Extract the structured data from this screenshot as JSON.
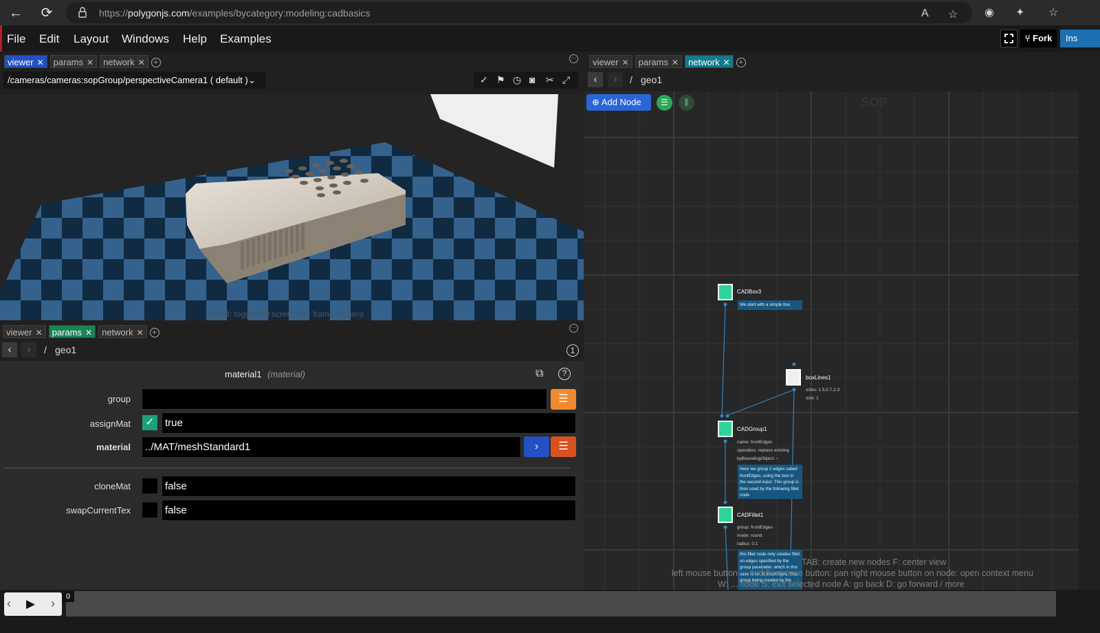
{
  "browser": {
    "url_prefix": "https://",
    "url_domain": "polygonjs.com",
    "url_path": "/examples/bycategory:modeling:cadbasics"
  },
  "menu": {
    "items": [
      "File",
      "Edit",
      "Layout",
      "Windows",
      "Help",
      "Examples"
    ],
    "fork_label": "Fork",
    "ins_label": "Ins"
  },
  "viewer_panel": {
    "tabs": [
      "viewer",
      "params",
      "network"
    ],
    "active_tab": "viewer",
    "camera_path": "/cameras/cameras:sopGroup/perspectiveCamera1 ( default )",
    "hint": "Ctrl+B: toggle full screen / F: frame camera"
  },
  "params_panel": {
    "tabs": [
      "viewer",
      "params",
      "network"
    ],
    "active_tab": "params",
    "path_sep": "/",
    "path": "geo1",
    "badge": "1",
    "node_name": "material1",
    "node_type": "(material)",
    "params": [
      {
        "label": "group",
        "value": ""
      },
      {
        "label": "assignMat",
        "value": "true"
      },
      {
        "label": "material",
        "value": "../MAT/meshStandard1"
      },
      {
        "label": "cloneMat",
        "value": "false"
      },
      {
        "label": "swapCurrentTex",
        "value": "false"
      }
    ]
  },
  "network_panel": {
    "tabs": [
      "viewer",
      "params",
      "network"
    ],
    "active_tab": "network",
    "path_sep": "/",
    "path": "geo1",
    "add_node_label": "Add Node",
    "context_label": "SOP",
    "nodes": [
      {
        "name": "CADBox3",
        "note": "We start with a simple box"
      },
      {
        "name": "boxLines1",
        "params": [
          "sizes: 1.5,0.7,2.3",
          "size: 1"
        ]
      },
      {
        "name": "CADGroup1",
        "params": [
          "name: frontEdges",
          "operation: replace existing",
          "byBoundingObject: ○"
        ],
        "note": "Here we group 2 edges called frontEdges, using the box in the second input. This group is then used by the following fillet node"
      },
      {
        "name": "CADFillet1",
        "params": [
          "group: frontEdges",
          "mode: round",
          "radius: 0.1"
        ],
        "note": "this fillet node only creates fillet on edges specified by the group parameter, which in this case is set to frontEdges. This group being created by the"
      }
    ],
    "hints": [
      "TAB: create new nodes  F: center view",
      "left mouse button ...  middle mouse button: pan   right mouse button on node: open context menu",
      "W: ... node  S: exit selected node  A: go back  D: go forward  / more"
    ]
  },
  "timeline": {
    "frame": "0"
  },
  "colors": {
    "accent_blue": "#2351c4",
    "accent_green": "#198355",
    "accent_teal": "#137a8b",
    "node_green": "#2fd49a",
    "orange": "#f08a2c"
  }
}
